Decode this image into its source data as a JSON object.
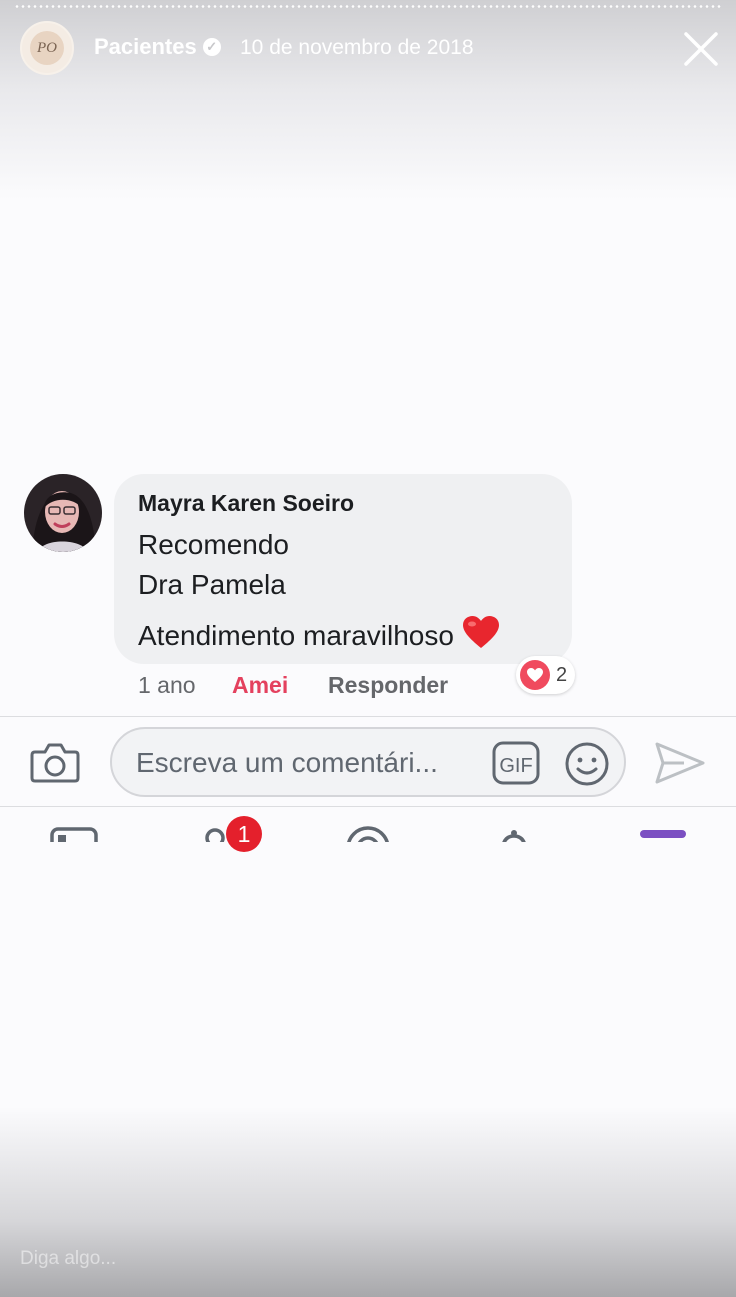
{
  "story": {
    "username": "Pacientes",
    "date": "10 de novembro de 2018",
    "avatar_monogram": "PO",
    "verified_icon": "check-badge-icon",
    "close_icon": "close-icon"
  },
  "comment": {
    "author": "Mayra Karen Soeiro",
    "lines": [
      "Recomendo",
      "Dra Pamela",
      "Atendimento maravilhoso"
    ],
    "emoji": "heart-emoji",
    "time": "1 ano",
    "like_label": "Amei",
    "reply_label": "Responder",
    "reaction_count": "2",
    "reaction_color": "#f04a5e"
  },
  "composer": {
    "placeholder": "Escreva um comentári...",
    "gif_label": "GIF"
  },
  "nav": {
    "notification_count": "1",
    "active_color": "#7b4fc2"
  },
  "reply_bar": {
    "placeholder": "Diga algo..."
  }
}
